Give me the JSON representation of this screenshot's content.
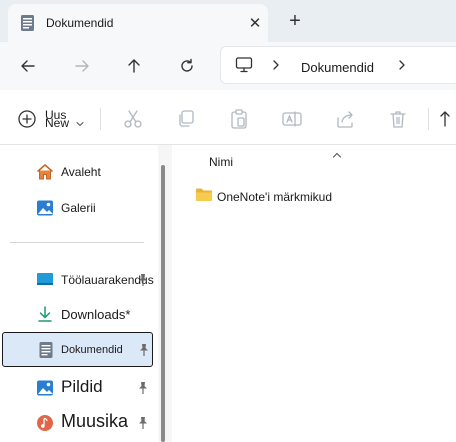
{
  "tab": {
    "title": "Dokumendid",
    "icon": "documents-folder-icon",
    "close_glyph": "✕",
    "new_tab_glyph": "+"
  },
  "nav": {
    "icons": [
      "back-arrow-icon",
      "forward-arrow-icon",
      "up-arrow-icon",
      "refresh-icon"
    ],
    "address": {
      "location_icon": "this-pc-icon",
      "path": [
        "Dokumendid"
      ]
    }
  },
  "command_bar": {
    "new_label_line1": "Uus",
    "new_label_line2": "New",
    "icons": [
      "cut-icon",
      "copy-icon",
      "paste-icon",
      "rename-icon",
      "share-icon",
      "delete-icon",
      "sort-icon"
    ]
  },
  "sidebar": {
    "quick_items": [
      {
        "label": "Avaleht",
        "icon": "home-icon"
      },
      {
        "label": "Galerii",
        "icon": "gallery-icon"
      }
    ],
    "pinned_items": [
      {
        "label": "Töölauarakendus",
        "icon": "desktop-icon",
        "pinned": true,
        "font_size": 12
      },
      {
        "label": "Downloads*",
        "icon": "downloads-icon",
        "pinned": false,
        "font_size": 13
      },
      {
        "label": "Dokumendid",
        "icon": "documents-icon",
        "pinned": true,
        "selected": true,
        "font_size": 11
      },
      {
        "label": "Pildid",
        "icon": "pictures-icon",
        "pinned": true,
        "font_size": 17
      },
      {
        "label": "Muusika",
        "icon": "music-icon",
        "pinned": true,
        "font_size": 18
      }
    ]
  },
  "content": {
    "column_header": "Nimi",
    "files": [
      {
        "name": "OneNote'i märkmikud",
        "icon": "folder-icon"
      }
    ]
  },
  "colors": {
    "accent": "#0067c0",
    "selection": "#dbe8f8",
    "folder": "#f5c542",
    "titlebar": "#e9eef3"
  }
}
